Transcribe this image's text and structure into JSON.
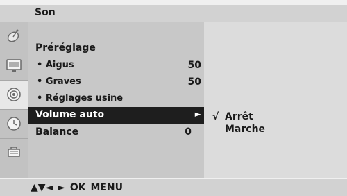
{
  "header": {
    "title": "Son"
  },
  "icons": [
    "satellite-dish-icon",
    "tv-screen-icon",
    "speaker-icon",
    "clock-icon",
    "lock-icon"
  ],
  "menu": {
    "items": [
      {
        "label": "Préréglage",
        "value": ""
      },
      {
        "label": "• Aigus",
        "value": "50"
      },
      {
        "label": "• Graves",
        "value": "50"
      },
      {
        "label": "• Réglages usine",
        "value": ""
      },
      {
        "label": "Volume auto",
        "value": "►"
      },
      {
        "label": "Balance",
        "value": "0"
      }
    ]
  },
  "submenu": {
    "options": [
      {
        "check": "√",
        "label": "Arrêt"
      },
      {
        "check": "",
        "label": "Marche"
      }
    ]
  },
  "footer": {
    "hint": "▲▼◄ ► OK MENU"
  }
}
